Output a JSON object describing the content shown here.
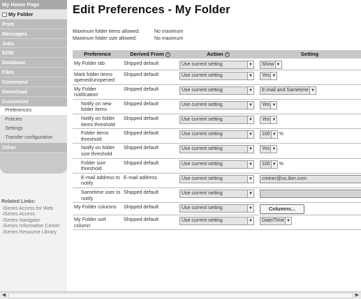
{
  "sidebar": {
    "home": "My Home Page",
    "my_folder": "My Folder",
    "items": [
      "Print",
      "Messages",
      "Jobs",
      "5250",
      "Database",
      "Files",
      "Command",
      "Download",
      "Customize"
    ],
    "sub_items": [
      "Preferences",
      "Policies",
      "Settings",
      "Transfer configuration"
    ],
    "other": "Other"
  },
  "related": {
    "title": "Related Links:",
    "links": [
      "iSeries Access for Web",
      "iSeries Access",
      "iSeries Navigator",
      "iSeries Information Center",
      "iSeries Resource Library"
    ]
  },
  "page": {
    "title": "Edit Preferences - My Folder",
    "limits": [
      {
        "label": "Maximum folder items allowed:",
        "value": "No maximum"
      },
      {
        "label": "Maximum folder size allowed:",
        "value": "No maximum"
      }
    ]
  },
  "table": {
    "headers": {
      "preference": "Preference",
      "derived": "Derived From",
      "action": "Action",
      "setting": "Setting"
    },
    "rows": [
      {
        "pref": "My Folder tab",
        "derived": "Shipped default",
        "action": "Use current setting",
        "setting": "Show",
        "type": "select"
      },
      {
        "pref": "Mark folder items opened/unopened",
        "derived": "Shipped default",
        "action": "Use current setting",
        "setting": "Yes",
        "type": "select"
      },
      {
        "pref": "My Folder notification",
        "derived": "Shipped default",
        "action": "Use current setting",
        "setting": "E-mail and Sametime",
        "type": "select"
      },
      {
        "pref": "Notify on new folder items",
        "derived": "Shipped default",
        "action": "Use current setting",
        "setting": "Yes",
        "type": "select",
        "indent": true
      },
      {
        "pref": "Notify on folder items threshold",
        "derived": "Shipped default",
        "action": "Use current setting",
        "setting": "Yes",
        "type": "select",
        "indent": true
      },
      {
        "pref": "Folder items threshold",
        "derived": "Shipped default",
        "action": "Use current setting",
        "setting": "100",
        "unit": "%",
        "type": "select-unit",
        "indent": true
      },
      {
        "pref": "Notify on folder size threshold",
        "derived": "Shipped default",
        "action": "Use current setting",
        "setting": "Yes",
        "type": "select",
        "indent": true
      },
      {
        "pref": "Folder size threshold",
        "derived": "Shipped default",
        "action": "Use current setting",
        "setting": "100",
        "unit": "%",
        "type": "select-unit",
        "indent": true
      },
      {
        "pref": "E-mail address to notify",
        "derived": "E-mail address",
        "action": "Use current setting",
        "setting": "cminer@us.ibm.com",
        "type": "text",
        "indent": true
      },
      {
        "pref": "Sametime user to notify",
        "derived": "Shipped default",
        "action": "Use current setting",
        "setting": "",
        "type": "text-disabled",
        "indent": true
      },
      {
        "pref": "My Folder columns",
        "derived": "Shipped default",
        "action": "Use current setting",
        "setting": "Columns...",
        "type": "button"
      },
      {
        "pref": "My Folder sort column",
        "derived": "Shipped default",
        "action": "Use current setting",
        "setting": "Date/Time",
        "type": "select"
      }
    ]
  },
  "icons": {
    "help": "help-icon",
    "folder": "folder-icon",
    "dropdown": "chevron-down-icon"
  }
}
